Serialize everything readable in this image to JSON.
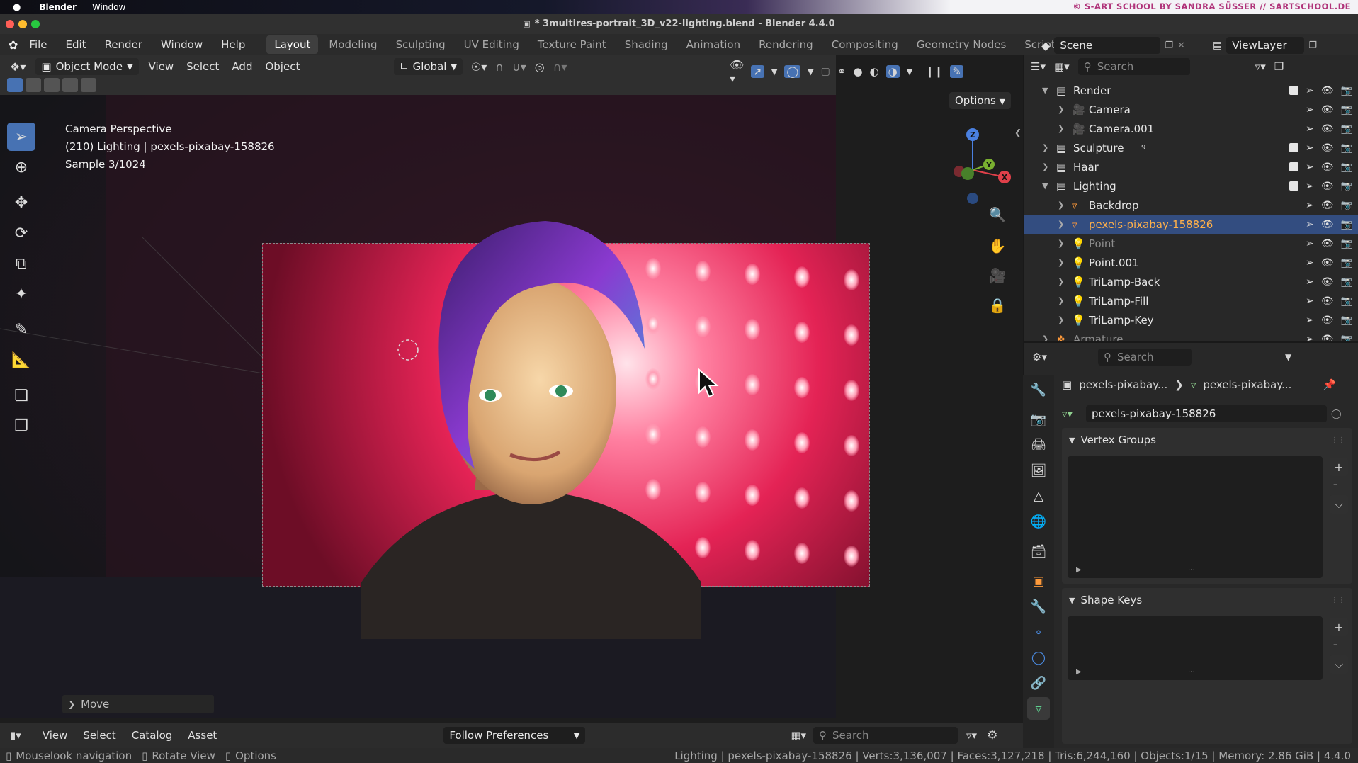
{
  "mac_menu": {
    "apple": "",
    "app": "Blender",
    "window": "Window",
    "credit": "© S-ART SCHOOL BY SANDRA SÜSSER // SARTSCHOOL.DE"
  },
  "title": "* 3multires-portrait_3D_v22-lighting.blend - Blender 4.4.0",
  "top_menu": {
    "items": [
      "File",
      "Edit",
      "Render",
      "Window",
      "Help"
    ],
    "workspaces": [
      "Layout",
      "Modeling",
      "Sculpting",
      "UV Editing",
      "Texture Paint",
      "Shading",
      "Animation",
      "Rendering",
      "Compositing",
      "Geometry Nodes",
      "Script"
    ],
    "active_workspace": "Layout",
    "scene": "Scene",
    "view_layer": "ViewLayer"
  },
  "viewport_header": {
    "mode": "Object Mode",
    "menus": [
      "View",
      "Select",
      "Add",
      "Object"
    ],
    "transform_orientation": "Global",
    "options": "Options"
  },
  "viewport_overlay": {
    "line1": "Camera Perspective",
    "line2": "(210) Lighting | pexels-pixabay-158826",
    "line3": "Sample 3/1024"
  },
  "gizmo": {
    "z": "Z",
    "y": "Y",
    "x": "X"
  },
  "move_panel": "Move",
  "timeline_header": {
    "menus": [
      "View",
      "Select",
      "Catalog",
      "Asset"
    ],
    "dropdown": "Follow Preferences",
    "search_placeholder": "Search"
  },
  "status_bar": {
    "left": [
      "Mouselook navigation",
      "Rotate View",
      "Options"
    ],
    "right": "Lighting | pexels-pixabay-158826 | Verts:3,136,007 | Faces:3,127,218 | Tris:6,244,160 | Objects:1/15 | Memory: 2.86 GiB | 4.4.0"
  },
  "outliner": {
    "search_placeholder": "Search",
    "rows": [
      {
        "label": "Render",
        "indent": 0,
        "type": "collection",
        "checkbox": true
      },
      {
        "label": "Camera",
        "indent": 1,
        "type": "camera"
      },
      {
        "label": "Camera.001",
        "indent": 1,
        "type": "camera"
      },
      {
        "label": "Sculpture",
        "indent": 0,
        "type": "collection",
        "checkbox": true,
        "badge": "9"
      },
      {
        "label": "Haar",
        "indent": 0,
        "type": "collection",
        "checkbox": true
      },
      {
        "label": "Lighting",
        "indent": 0,
        "type": "collection",
        "checkbox": true
      },
      {
        "label": "Backdrop",
        "indent": 1,
        "type": "mesh"
      },
      {
        "label": "pexels-pixabay-158826",
        "indent": 1,
        "type": "mesh",
        "selected": true
      },
      {
        "label": "Point",
        "indent": 1,
        "type": "light",
        "dim": true
      },
      {
        "label": "Point.001",
        "indent": 1,
        "type": "light"
      },
      {
        "label": "TriLamp-Back",
        "indent": 1,
        "type": "light"
      },
      {
        "label": "TriLamp-Fill",
        "indent": 1,
        "type": "light"
      },
      {
        "label": "TriLamp-Key",
        "indent": 1,
        "type": "light"
      },
      {
        "label": "Armature",
        "indent": 0,
        "type": "armature",
        "dim": true
      }
    ]
  },
  "properties": {
    "search_placeholder": "Search",
    "breadcrumb": [
      "pexels-pixabay...",
      "pexels-pixabay..."
    ],
    "data_name": "pexels-pixabay-158826",
    "panels": [
      "Vertex Groups",
      "Shape Keys"
    ]
  }
}
